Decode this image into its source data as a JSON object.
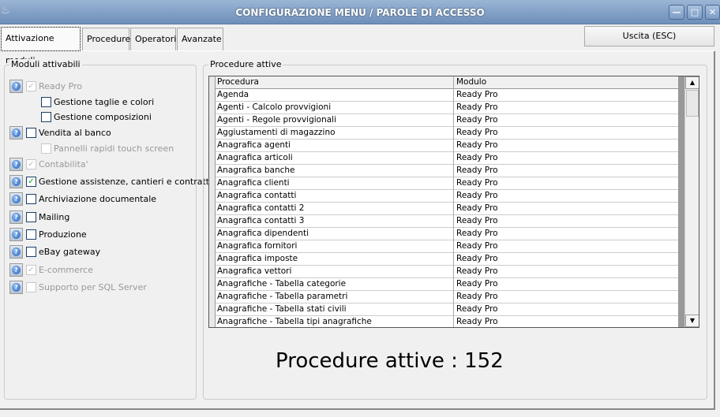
{
  "window": {
    "title": "CONFIGURAZIONE MENU / PAROLE DI ACCESSO",
    "controls": [
      "minimize",
      "maximize",
      "close"
    ]
  },
  "tabs": [
    {
      "label": "Attivazione moduli",
      "active": true
    },
    {
      "label": "Procedure"
    },
    {
      "label": "Operatori"
    },
    {
      "label": "Avanzate"
    }
  ],
  "exit_button": "Uscita (ESC)",
  "modules": {
    "title": "Moduli attivabili",
    "items": [
      {
        "label": "Ready Pro",
        "checked": true,
        "disabled": true,
        "help": true,
        "indent": 0
      },
      {
        "label": "Gestione taglie e colori",
        "checked": false,
        "disabled": false,
        "help": false,
        "indent": 1
      },
      {
        "label": "Gestione composizioni",
        "checked": false,
        "disabled": false,
        "help": false,
        "indent": 1
      },
      {
        "label": "Vendita al banco",
        "checked": false,
        "disabled": false,
        "help": true,
        "indent": 0
      },
      {
        "label": "Pannelli rapidi touch screen",
        "checked": false,
        "disabled": true,
        "help": false,
        "indent": 1
      },
      {
        "label": "Contabilita'",
        "checked": true,
        "disabled": true,
        "help": true,
        "indent": 0
      },
      {
        "label": "Gestione assistenze, cantieri e contratti",
        "checked": true,
        "disabled": false,
        "help": true,
        "indent": 0
      },
      {
        "label": "Archiviazione documentale",
        "checked": false,
        "disabled": false,
        "help": true,
        "indent": 0
      },
      {
        "label": "Mailing",
        "checked": false,
        "disabled": false,
        "help": true,
        "indent": 0
      },
      {
        "label": "Produzione",
        "checked": false,
        "disabled": false,
        "help": true,
        "indent": 0
      },
      {
        "label": "eBay gateway",
        "checked": false,
        "disabled": false,
        "help": true,
        "indent": 0
      },
      {
        "label": "E-commerce",
        "checked": true,
        "disabled": true,
        "help": true,
        "indent": 0
      },
      {
        "label": "Supporto per SQL Server",
        "checked": false,
        "disabled": true,
        "help": true,
        "indent": 0
      }
    ]
  },
  "procedures": {
    "title": "Procedure attive",
    "columns": [
      "Procedura",
      "Modulo"
    ],
    "rows": [
      [
        "Agenda",
        "Ready Pro"
      ],
      [
        "Agenti - Calcolo provvigioni",
        "Ready Pro"
      ],
      [
        "Agenti - Regole provvigionali",
        "Ready Pro"
      ],
      [
        "Aggiustamenti di magazzino",
        "Ready Pro"
      ],
      [
        "Anagrafica agenti",
        "Ready Pro"
      ],
      [
        "Anagrafica articoli",
        "Ready Pro"
      ],
      [
        "Anagrafica banche",
        "Ready Pro"
      ],
      [
        "Anagrafica clienti",
        "Ready Pro"
      ],
      [
        "Anagrafica contatti",
        "Ready Pro"
      ],
      [
        "Anagrafica contatti 2",
        "Ready Pro"
      ],
      [
        "Anagrafica contatti 3",
        "Ready Pro"
      ],
      [
        "Anagrafica dipendenti",
        "Ready Pro"
      ],
      [
        "Anagrafica fornitori",
        "Ready Pro"
      ],
      [
        "Anagrafica imposte",
        "Ready Pro"
      ],
      [
        "Anagrafica vettori",
        "Ready Pro"
      ],
      [
        "Anagrafiche - Tabella categorie",
        "Ready Pro"
      ],
      [
        "Anagrafiche - Tabella parametri",
        "Ready Pro"
      ],
      [
        "Anagrafiche - Tabella stati civili",
        "Ready Pro"
      ],
      [
        "Anagrafiche - Tabella tipi anagrafiche",
        "Ready Pro"
      ]
    ],
    "count_label": "Procedure attive : 152"
  }
}
